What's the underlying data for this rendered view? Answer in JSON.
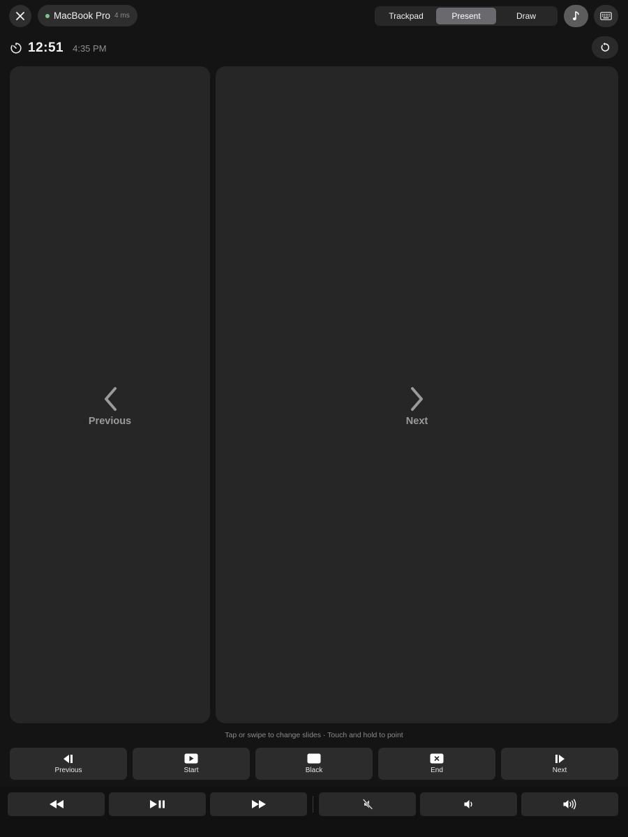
{
  "header": {
    "device": {
      "name": "MacBook Pro",
      "latency": "4 ms",
      "status_color": "#7fc48a"
    },
    "modes": [
      {
        "label": "Trackpad",
        "active": false
      },
      {
        "label": "Present",
        "active": true
      },
      {
        "label": "Draw",
        "active": false
      }
    ],
    "icons": {
      "close": "close-icon",
      "music": "music-note-icon",
      "keyboard": "keyboard-icon"
    }
  },
  "timer": {
    "elapsed": "12:51",
    "clock": "4:35 PM",
    "icons": {
      "timer": "timer-icon",
      "reset": "reset-icon"
    }
  },
  "panels": {
    "previous": {
      "label": "Previous",
      "icon": "chevron-left-icon"
    },
    "next": {
      "label": "Next",
      "icon": "chevron-right-icon"
    }
  },
  "hint": "Tap or swipe to change slides · Touch and hold to point",
  "slide_controls": [
    {
      "label": "Previous",
      "icon": "previous-slide-icon"
    },
    {
      "label": "Start",
      "icon": "play-start-icon"
    },
    {
      "label": "Black",
      "icon": "black-screen-icon"
    },
    {
      "label": "End",
      "icon": "end-show-icon"
    },
    {
      "label": "Next",
      "icon": "next-slide-icon"
    }
  ],
  "media_controls": [
    {
      "icon": "rewind-icon"
    },
    {
      "icon": "play-pause-icon"
    },
    {
      "icon": "fast-forward-icon"
    },
    {
      "icon": "mute-icon"
    },
    {
      "icon": "volume-down-icon"
    },
    {
      "icon": "volume-up-icon"
    }
  ],
  "colors": {
    "background": "#141414",
    "panel": "#262626",
    "active_segment": "#6a6a6e"
  }
}
